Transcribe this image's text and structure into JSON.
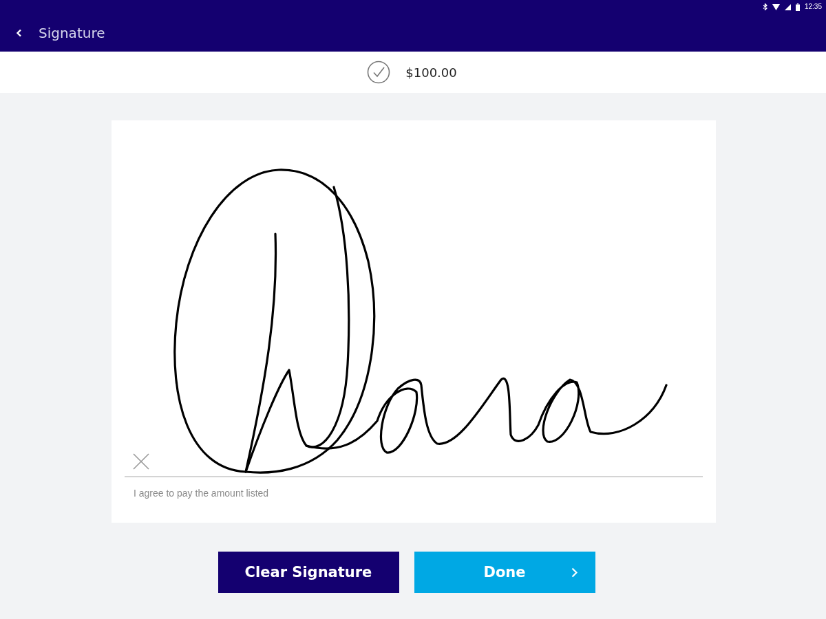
{
  "status_bar": {
    "time": "12:35"
  },
  "app_bar": {
    "title": "Signature"
  },
  "payment": {
    "amount": "$100.00"
  },
  "signature_pad": {
    "agreement": "I agree to pay the amount listed"
  },
  "buttons": [
    {
      "label": "Clear Signature",
      "kind": "secondary"
    },
    {
      "label": "Done",
      "kind": "primary"
    }
  ]
}
